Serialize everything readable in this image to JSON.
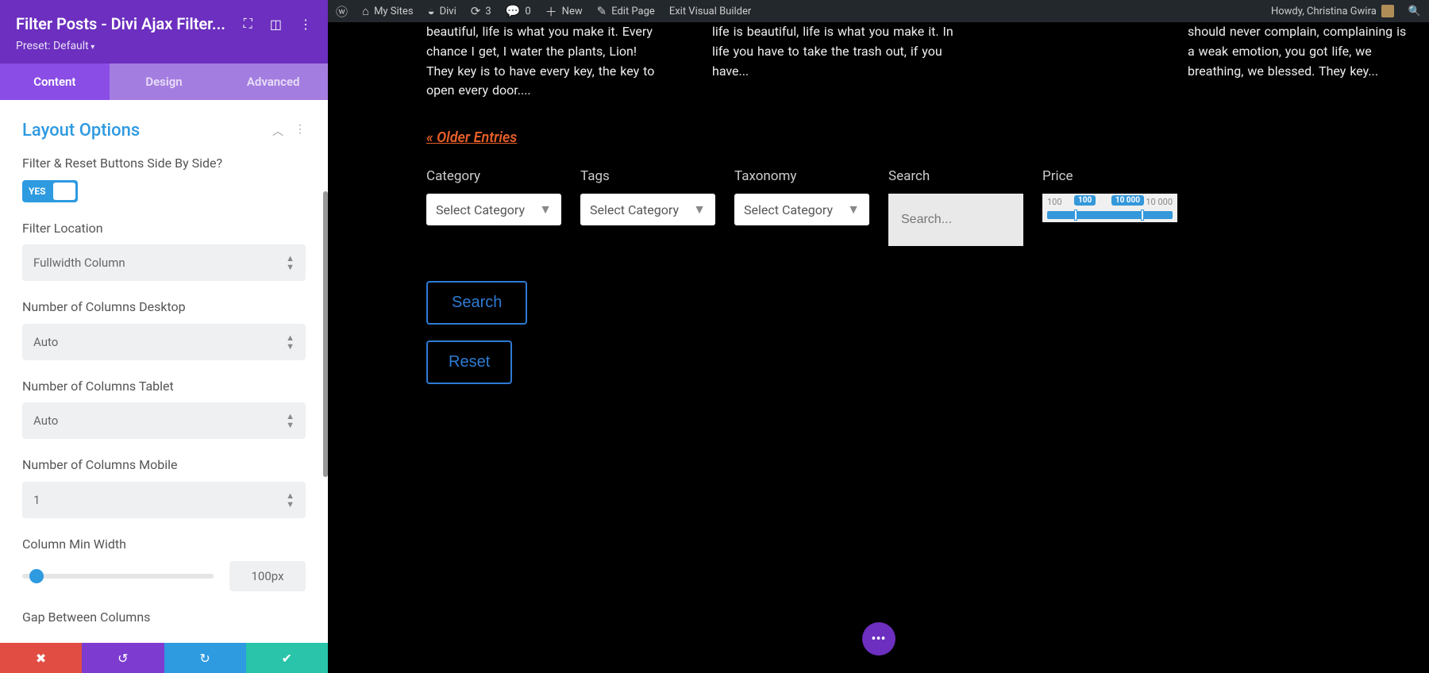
{
  "sidebar": {
    "title": "Filter Posts - Divi Ajax Filter...",
    "preset": "Preset: Default",
    "tabs": {
      "content": "Content",
      "design": "Design",
      "advanced": "Advanced"
    },
    "section_title": "Layout Options",
    "opts": {
      "sideBySide": {
        "label": "Filter & Reset Buttons Side By Side?",
        "toggle": "YES"
      },
      "filterLocation": {
        "label": "Filter Location",
        "value": "Fullwidth Column"
      },
      "colsDesktop": {
        "label": "Number of Columns Desktop",
        "value": "Auto"
      },
      "colsTablet": {
        "label": "Number of Columns Tablet",
        "value": "Auto"
      },
      "colsMobile": {
        "label": "Number of Columns Mobile",
        "value": "1"
      },
      "minWidth": {
        "label": "Column Min Width",
        "value": "100px"
      },
      "gap": {
        "label": "Gap Between Columns"
      }
    }
  },
  "adminbar": {
    "mySites": "My Sites",
    "divi": "Divi",
    "updates": "3",
    "comments": "0",
    "new": "New",
    "editPage": "Edit Page",
    "exitVB": "Exit Visual Builder",
    "howdy": "Howdy, Christina Gwira"
  },
  "posts": [
    "beautiful, life is what you make it. Every chance I get, I water the plants, Lion! They key is to have every key, the key to open every door....",
    "life is beautiful, life is what you make it. In life you have to take the trash out, if you have...",
    "should never complain, complaining is a weak emotion, you got life, we breathing, we blessed. They key..."
  ],
  "olderEntries": "« Older Entries",
  "filters": {
    "category": {
      "label": "Category",
      "value": "Select Category"
    },
    "tags": {
      "label": "Tags",
      "value": "Select Category"
    },
    "taxonomy": {
      "label": "Taxonomy",
      "value": "Select Category"
    },
    "search": {
      "label": "Search",
      "placeholder": "Search..."
    },
    "price": {
      "label": "Price",
      "minLabel": "100",
      "tag1": "100",
      "tag2": "10 000",
      "maxLabel": "10 000"
    }
  },
  "buttons": {
    "search": "Search",
    "reset": "Reset"
  }
}
